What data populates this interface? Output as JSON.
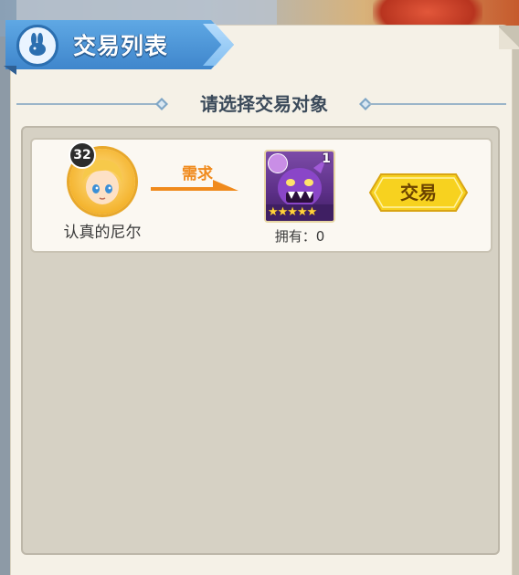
{
  "window": {
    "title": "交易列表"
  },
  "header": {
    "subtitle": "请选择交易对象"
  },
  "trade_rows": [
    {
      "player": {
        "level": "32",
        "name": "认真的尼尔"
      },
      "demand_label": "需求",
      "item": {
        "count": "1",
        "stars": "★★★★★",
        "owned": "拥有：0"
      },
      "action_label": "交易"
    }
  ],
  "colors": {
    "banner": "#3f86cc",
    "accent_orange": "#f08a1c",
    "trade_button": "#f7d21f",
    "panel": "#f5f1e7",
    "list_bg": "#d6d1c4"
  }
}
